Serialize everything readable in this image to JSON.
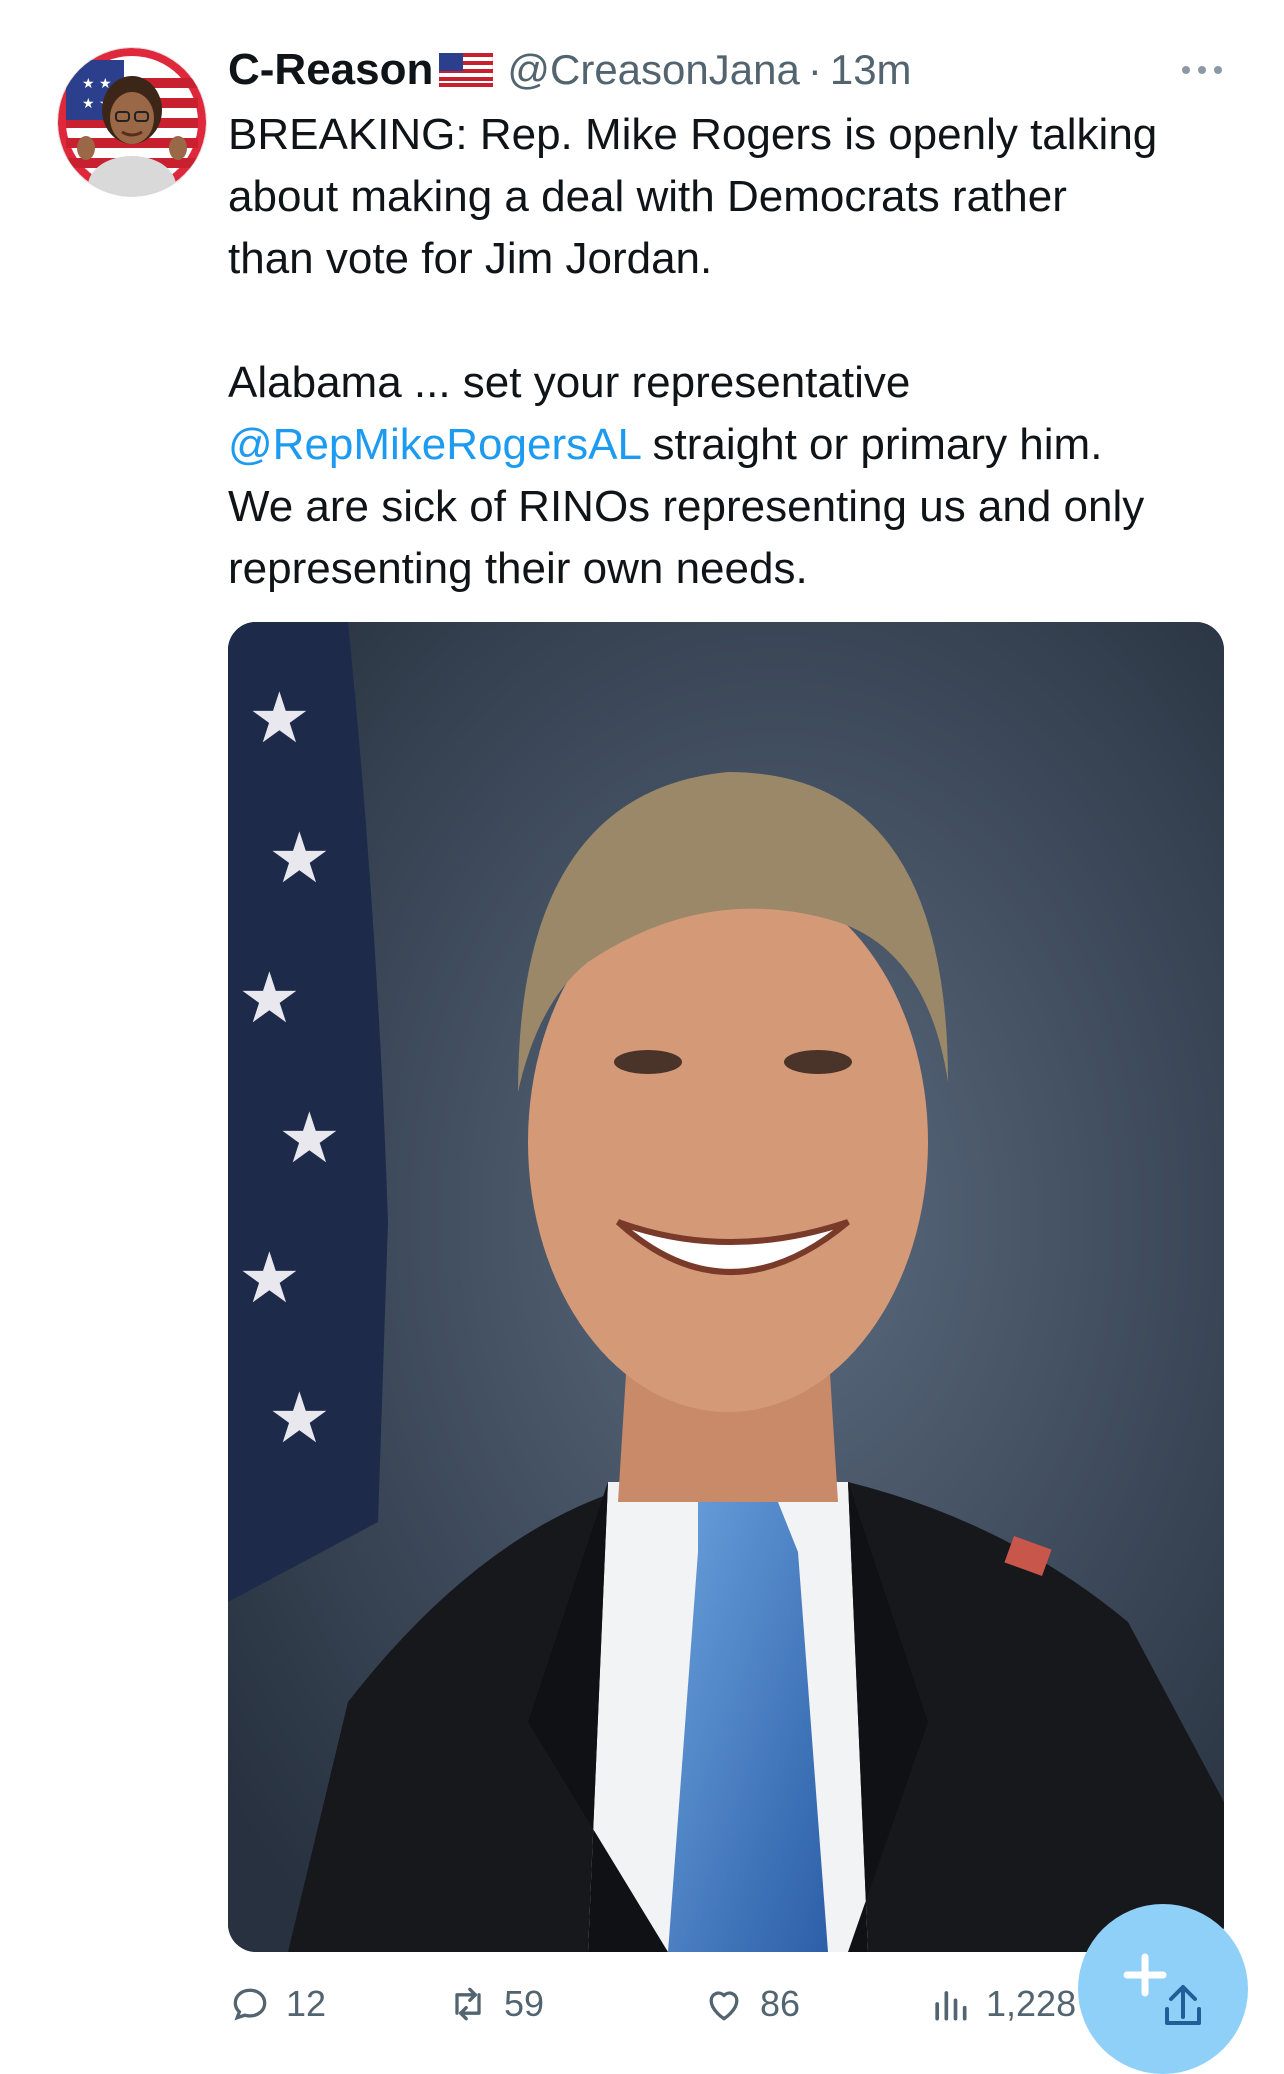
{
  "tweet": {
    "author_name": "C-Reason",
    "author_flag": "flag-us-icon",
    "handle": "@CreasonJana",
    "separator": "·",
    "time": "13m",
    "text_lines": [
      "BREAKING: Rep. Mike Rogers is openly talking",
      "about making a deal with Democrats rather",
      "than vote for Jim Jordan."
    ],
    "text2_line1": "Alabama ... set your representative",
    "mention": "@RepMikeRogersAL",
    "text2_after_mention": " straight or primary him.",
    "text2_line3": "We are sick of RINOs representing us and only",
    "text2_line4": "representing their own needs."
  },
  "actions": {
    "replies": "12",
    "retweets": "59",
    "likes": "86",
    "views": "1,228"
  },
  "colors": {
    "accent": "#1d9bf0",
    "muted": "#536471",
    "text": "#0f1419",
    "fab": "#8fd0f8"
  }
}
